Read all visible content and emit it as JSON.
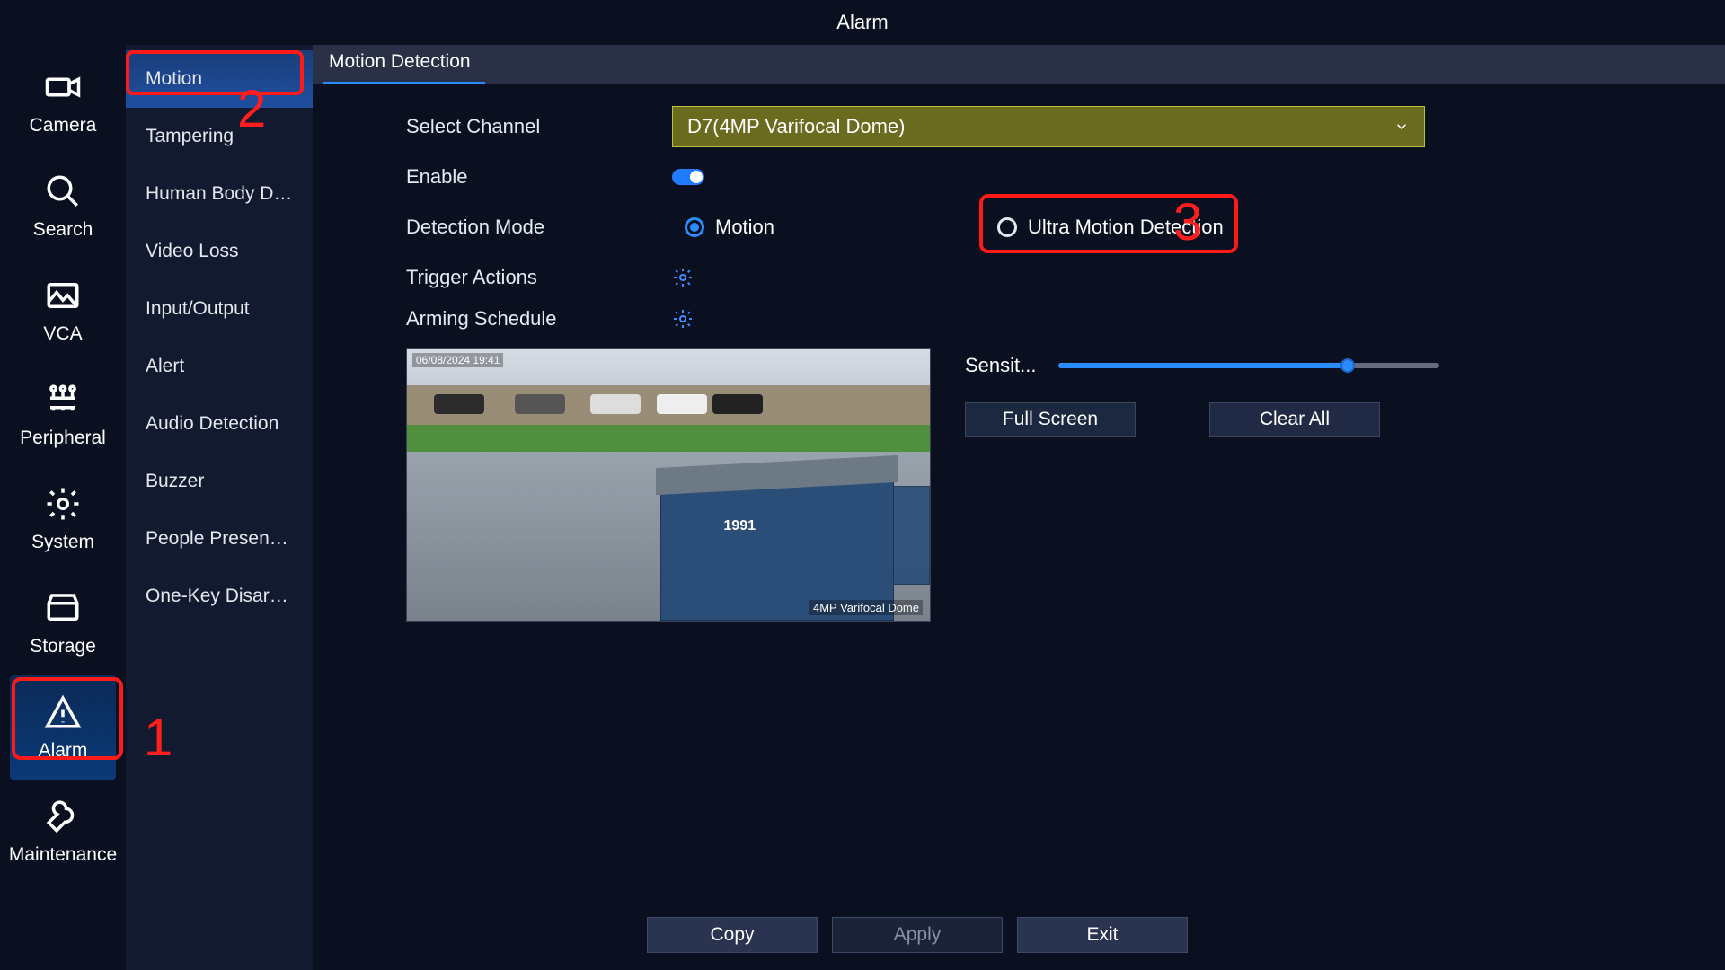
{
  "title": "Alarm",
  "rail": [
    {
      "label": "Camera"
    },
    {
      "label": "Search"
    },
    {
      "label": "VCA"
    },
    {
      "label": "Peripheral"
    },
    {
      "label": "System"
    },
    {
      "label": "Storage"
    },
    {
      "label": "Alarm"
    },
    {
      "label": "Maintenance"
    }
  ],
  "submenu": [
    "Motion",
    "Tampering",
    "Human Body Det...",
    "Video Loss",
    "Input/Output",
    "Alert",
    "Audio Detection",
    "Buzzer",
    "People Present A...",
    "One-Key Disarmi.."
  ],
  "tab": "Motion Detection",
  "form": {
    "select_channel_label": "Select Channel",
    "select_channel_value": "D7(4MP Varifocal Dome)",
    "enable_label": "Enable",
    "detection_mode_label": "Detection Mode",
    "mode_motion": "Motion",
    "mode_ultra": "Ultra Motion Detection",
    "trigger_label": "Trigger Actions",
    "arming_label": "Arming Schedule",
    "sensitivity_label": "Sensit...",
    "sensitivity_pct": 75,
    "full_screen": "Full Screen",
    "clear_all": "Clear All"
  },
  "preview": {
    "timestamp": "06/08/2024 19:41",
    "cam_text": "4MP Varifocal Dome",
    "dumpster_number": "1991"
  },
  "footer": {
    "copy": "Copy",
    "apply": "Apply",
    "exit": "Exit"
  },
  "callouts": {
    "one": "1",
    "two": "2",
    "three": "3"
  },
  "colors": {
    "accent": "#2b8cff",
    "highlight": "#ff1a1a",
    "select_bg": "#6a6b1f"
  }
}
